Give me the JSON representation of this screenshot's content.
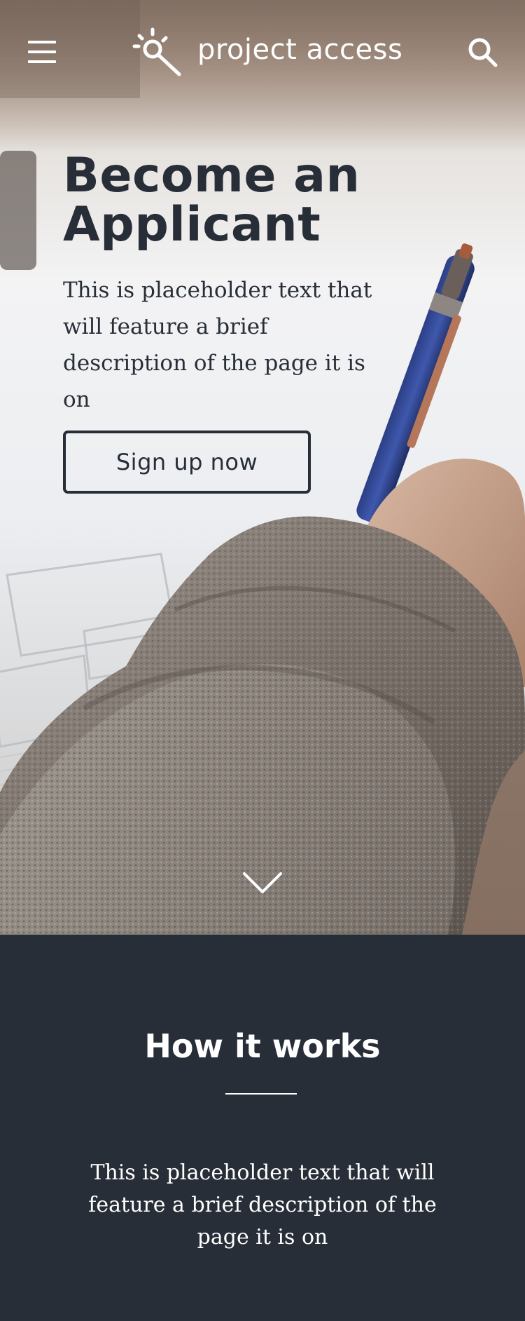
{
  "header": {
    "brand_name": "project access",
    "menu_icon": "hamburger-menu-icon",
    "search_icon": "search-icon",
    "logo_icon": "magnifier-sparkle-logo-icon"
  },
  "hero": {
    "title": "Become an Applicant",
    "description": "This is placeholder text that will feature a brief description of the page it is on",
    "cta_label": "Sign up now",
    "scroll_icon": "chevron-down-icon",
    "photo": "person-writing-with-pen-photo"
  },
  "how_it_works": {
    "title": "How it works",
    "description": "This is placeholder text that will feature a brief description of the page it is on"
  },
  "colors": {
    "dark": "#282e38",
    "white": "#ffffff"
  }
}
